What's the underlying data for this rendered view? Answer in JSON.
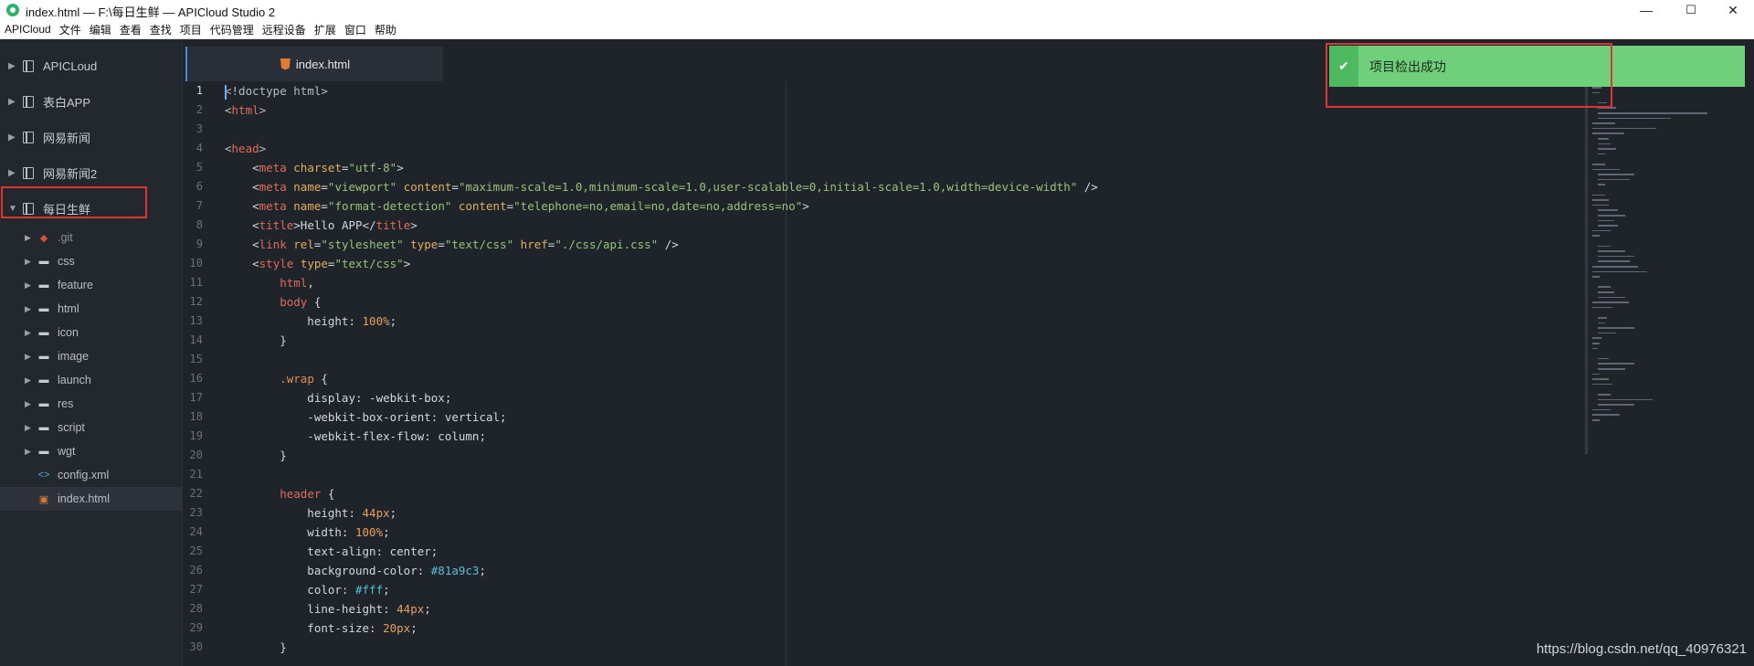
{
  "window": {
    "title": "index.html — F:\\每日生鲜 — APICloud Studio 2",
    "minimize_glyph": "—",
    "maximize_glyph": "☐",
    "close_glyph": "✕"
  },
  "menu": [
    "APICloud",
    "文件",
    "编辑",
    "查看",
    "查找",
    "项目",
    "代码管理",
    "远程设备",
    "扩展",
    "窗口",
    "帮助"
  ],
  "sidebar": {
    "projects": [
      {
        "label": "APICLoud",
        "expanded": false
      },
      {
        "label": "表白APP",
        "expanded": false
      },
      {
        "label": "网易新闻",
        "expanded": false
      },
      {
        "label": "网易新闻2",
        "expanded": false
      },
      {
        "label": "每日生鲜",
        "expanded": true
      }
    ],
    "tree": [
      {
        "label": ".git",
        "icon": "git-icon",
        "folder": true
      },
      {
        "label": "css",
        "icon": "folder-icon",
        "folder": true
      },
      {
        "label": "feature",
        "icon": "folder-icon",
        "folder": true
      },
      {
        "label": "html",
        "icon": "folder-icon",
        "folder": true
      },
      {
        "label": "icon",
        "icon": "folder-icon",
        "folder": true
      },
      {
        "label": "image",
        "icon": "folder-icon",
        "folder": true
      },
      {
        "label": "launch",
        "icon": "folder-icon",
        "folder": true
      },
      {
        "label": "res",
        "icon": "folder-icon",
        "folder": true
      },
      {
        "label": "script",
        "icon": "folder-icon",
        "folder": true
      },
      {
        "label": "wgt",
        "icon": "folder-icon",
        "folder": true
      },
      {
        "label": "config.xml",
        "icon": "xml-file-icon",
        "folder": false
      },
      {
        "label": "index.html",
        "icon": "html-file-icon",
        "folder": false,
        "selected": true
      }
    ]
  },
  "editor": {
    "tab_label": "index.html",
    "active_line": 1,
    "lines": [
      [
        [
          "t-punct",
          "<!doctype html>"
        ]
      ],
      [
        [
          "t-punct",
          "<"
        ],
        [
          "t-tag",
          "html"
        ],
        [
          "t-punct",
          ">"
        ]
      ],
      [],
      [
        [
          "t-punct",
          "<"
        ],
        [
          "t-tag",
          "head"
        ],
        [
          "t-punct",
          ">"
        ]
      ],
      [
        [
          "t-txt",
          "    <"
        ],
        [
          "t-tag",
          "meta"
        ],
        [
          "t-txt",
          " "
        ],
        [
          "t-attr",
          "charset"
        ],
        [
          "t-txt",
          "="
        ],
        [
          "t-str",
          "\"utf-8\""
        ],
        [
          "t-txt",
          ">"
        ]
      ],
      [
        [
          "t-txt",
          "    <"
        ],
        [
          "t-tag",
          "meta"
        ],
        [
          "t-txt",
          " "
        ],
        [
          "t-attr",
          "name"
        ],
        [
          "t-txt",
          "="
        ],
        [
          "t-str",
          "\"viewport\""
        ],
        [
          "t-txt",
          " "
        ],
        [
          "t-attr",
          "content"
        ],
        [
          "t-txt",
          "="
        ],
        [
          "t-str",
          "\"maximum-scale=1.0,minimum-scale=1.0,user-scalable=0,initial-scale=1.0,width=device-width\""
        ],
        [
          "t-txt",
          " />"
        ]
      ],
      [
        [
          "t-txt",
          "    <"
        ],
        [
          "t-tag",
          "meta"
        ],
        [
          "t-txt",
          " "
        ],
        [
          "t-attr",
          "name"
        ],
        [
          "t-txt",
          "="
        ],
        [
          "t-str",
          "\"format-detection\""
        ],
        [
          "t-txt",
          " "
        ],
        [
          "t-attr",
          "content"
        ],
        [
          "t-txt",
          "="
        ],
        [
          "t-str",
          "\"telephone=no,email=no,date=no,address=no\""
        ],
        [
          "t-txt",
          ">"
        ]
      ],
      [
        [
          "t-txt",
          "    <"
        ],
        [
          "t-tag",
          "title"
        ],
        [
          "t-txt",
          ">Hello APP</"
        ],
        [
          "t-tag",
          "title"
        ],
        [
          "t-txt",
          ">"
        ]
      ],
      [
        [
          "t-txt",
          "    <"
        ],
        [
          "t-tag",
          "link"
        ],
        [
          "t-txt",
          " "
        ],
        [
          "t-attr",
          "rel"
        ],
        [
          "t-txt",
          "="
        ],
        [
          "t-str",
          "\"stylesheet\""
        ],
        [
          "t-txt",
          " "
        ],
        [
          "t-attr",
          "type"
        ],
        [
          "t-txt",
          "="
        ],
        [
          "t-str",
          "\"text/css\""
        ],
        [
          "t-txt",
          " "
        ],
        [
          "t-attr",
          "href"
        ],
        [
          "t-txt",
          "="
        ],
        [
          "t-str",
          "\"./css/api.css\""
        ],
        [
          "t-txt",
          " />"
        ]
      ],
      [
        [
          "t-txt",
          "    <"
        ],
        [
          "t-tag",
          "style"
        ],
        [
          "t-txt",
          " "
        ],
        [
          "t-attr",
          "type"
        ],
        [
          "t-txt",
          "="
        ],
        [
          "t-str",
          "\"text/css\""
        ],
        [
          "t-txt",
          ">"
        ]
      ],
      [
        [
          "t-txt",
          "        "
        ],
        [
          "t-sel",
          "html"
        ],
        [
          "t-txt",
          ","
        ]
      ],
      [
        [
          "t-txt",
          "        "
        ],
        [
          "t-sel",
          "body"
        ],
        [
          "t-txt",
          " {"
        ]
      ],
      [
        [
          "t-txt",
          "            height: "
        ],
        [
          "t-num",
          "100%"
        ],
        [
          "t-txt",
          ";"
        ]
      ],
      [
        [
          "t-txt",
          "        }"
        ]
      ],
      [],
      [
        [
          "t-txt",
          "        "
        ],
        [
          "t-cls",
          ".wrap"
        ],
        [
          "t-txt",
          " {"
        ]
      ],
      [
        [
          "t-txt",
          "            display: -webkit-box;"
        ]
      ],
      [
        [
          "t-txt",
          "            -webkit-box-orient: vertical;"
        ]
      ],
      [
        [
          "t-txt",
          "            -webkit-flex-flow: column;"
        ]
      ],
      [
        [
          "t-txt",
          "        }"
        ]
      ],
      [],
      [
        [
          "t-txt",
          "        "
        ],
        [
          "t-sel",
          "header"
        ],
        [
          "t-txt",
          " {"
        ]
      ],
      [
        [
          "t-txt",
          "            height: "
        ],
        [
          "t-num",
          "44px"
        ],
        [
          "t-txt",
          ";"
        ]
      ],
      [
        [
          "t-txt",
          "            width: "
        ],
        [
          "t-num",
          "100%"
        ],
        [
          "t-txt",
          ";"
        ]
      ],
      [
        [
          "t-txt",
          "            text-align: center;"
        ]
      ],
      [
        [
          "t-txt",
          "            background-color: "
        ],
        [
          "t-hex",
          "#81a9c3"
        ],
        [
          "t-txt",
          ";"
        ]
      ],
      [
        [
          "t-txt",
          "            color: "
        ],
        [
          "t-hex",
          "#fff"
        ],
        [
          "t-txt",
          ";"
        ]
      ],
      [
        [
          "t-txt",
          "            line-height: "
        ],
        [
          "t-num",
          "44px"
        ],
        [
          "t-txt",
          ";"
        ]
      ],
      [
        [
          "t-txt",
          "            font-size: "
        ],
        [
          "t-num",
          "20px"
        ],
        [
          "t-txt",
          ";"
        ]
      ],
      [
        [
          "t-txt",
          "        }"
        ]
      ]
    ]
  },
  "notification": {
    "message": "项目检出成功",
    "icon": "check-icon",
    "color": "#6fcf7b"
  },
  "watermark": "https://blog.csdn.net/qq_40976321"
}
